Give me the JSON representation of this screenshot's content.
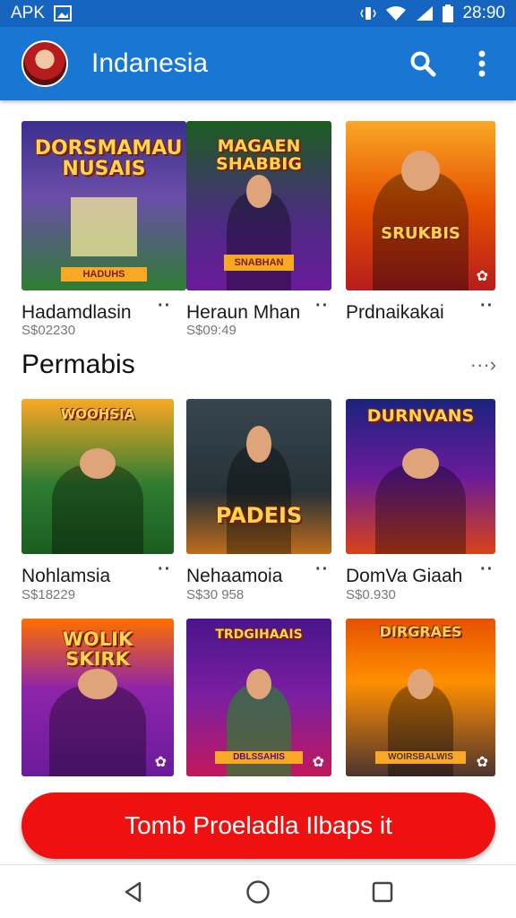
{
  "status_bar": {
    "left_text": "APK",
    "time": "28:90",
    "icons": [
      "image-icon",
      "vibrate-icon",
      "wifi-icon",
      "signal-icon",
      "battery-icon"
    ]
  },
  "app_bar": {
    "title": "Indanesia",
    "color": "#1976d2",
    "icons": [
      "avatar",
      "search-icon",
      "more-vert-icon"
    ]
  },
  "row1": [
    {
      "banner": "DORSMAMAU NUSAIS",
      "tag": "HADUHS",
      "title": "Hadamdlasin",
      "price": "S$02230",
      "colors": [
        "#3a2f8f",
        "#2e7d32"
      ]
    },
    {
      "banner": "MAGAEN SHABBIG",
      "tag": "SNABHAN",
      "title": "Heraun Mhan",
      "price": "S$09:49",
      "colors": [
        "#1b5e20",
        "#6a1b9a"
      ]
    },
    {
      "banner": "SRUKBIS",
      "tag": "",
      "title": "Prdnaikakai",
      "price": "",
      "colors": [
        "#f9a825",
        "#b71c1c"
      ]
    }
  ],
  "section": {
    "title": "Permabis",
    "more": "···›"
  },
  "row2": [
    {
      "banner": "WOOHSIA",
      "title": "Nohlamsia",
      "price": "S$18229",
      "colors": [
        "#2e7d32",
        "#f9a825"
      ]
    },
    {
      "banner": "PADEIS",
      "title": "Nehaamoia",
      "price": "S$30 958",
      "colors": [
        "#37474f",
        "#bf6d1a"
      ]
    },
    {
      "banner": "DURNVANS",
      "title": "DomVa Giaah",
      "price": "S$0.930",
      "colors": [
        "#1a237e",
        "#d84315"
      ]
    }
  ],
  "row3": [
    {
      "banner": "WOLIK SKIRK",
      "colors": [
        "#6a1b9a",
        "#ff6f00"
      ]
    },
    {
      "banner": "TRDGIHAAIS",
      "tag": "DBLSSAHIS",
      "colors": [
        "#4a148c",
        "#c2185b"
      ]
    },
    {
      "banner": "DIRGRAES",
      "tag": "WOIRSBALWIS",
      "colors": [
        "#e65100",
        "#4e342e"
      ]
    }
  ],
  "cta": {
    "label": "Tomb Proeladla Ilbaps it",
    "color": "#ef1010"
  },
  "nav": {
    "icons": [
      "back-icon",
      "home-icon",
      "recents-icon"
    ]
  }
}
